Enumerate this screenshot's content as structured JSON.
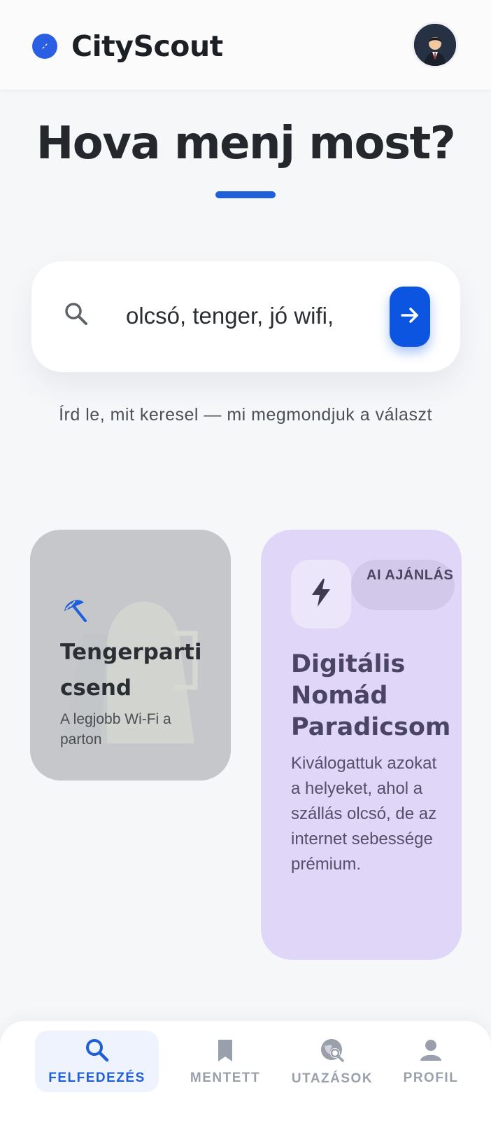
{
  "app": {
    "name": "CityScout"
  },
  "hero": {
    "title": "Hova menj most?"
  },
  "search": {
    "value": "olcsó, tenger, jó wifi,",
    "hint": "Írd le, mit keresel — mi megmondjuk a választ"
  },
  "cards": {
    "left": {
      "title": "Tengerparti csend",
      "subtitle": "A legjobb Wi-Fi a parton",
      "icon": "beach-umbrella-icon"
    },
    "right": {
      "badge": "AI AJÁNLÁS",
      "title": "Digitális Nomád Paradicsom",
      "description": "Kiválogattuk azokat a helyeket, ahol a szállás olcsó, de az internet sebessége prémium.",
      "icon": "bolt-icon"
    }
  },
  "nav": {
    "items": [
      {
        "label": "FELFEDEZÉS",
        "icon": "search-icon",
        "active": true
      },
      {
        "label": "MENTETT",
        "icon": "bookmark-icon",
        "active": false
      },
      {
        "label": "UTAZÁSOK",
        "icon": "travel-explore-icon",
        "active": false
      },
      {
        "label": "PROFIL",
        "icon": "person-icon",
        "active": false
      }
    ]
  },
  "colors": {
    "accent": "#1f5fd8",
    "button": "#0b55e0",
    "card_ai": "#e0d7f8",
    "nav_inactive": "#9aa0ab"
  }
}
